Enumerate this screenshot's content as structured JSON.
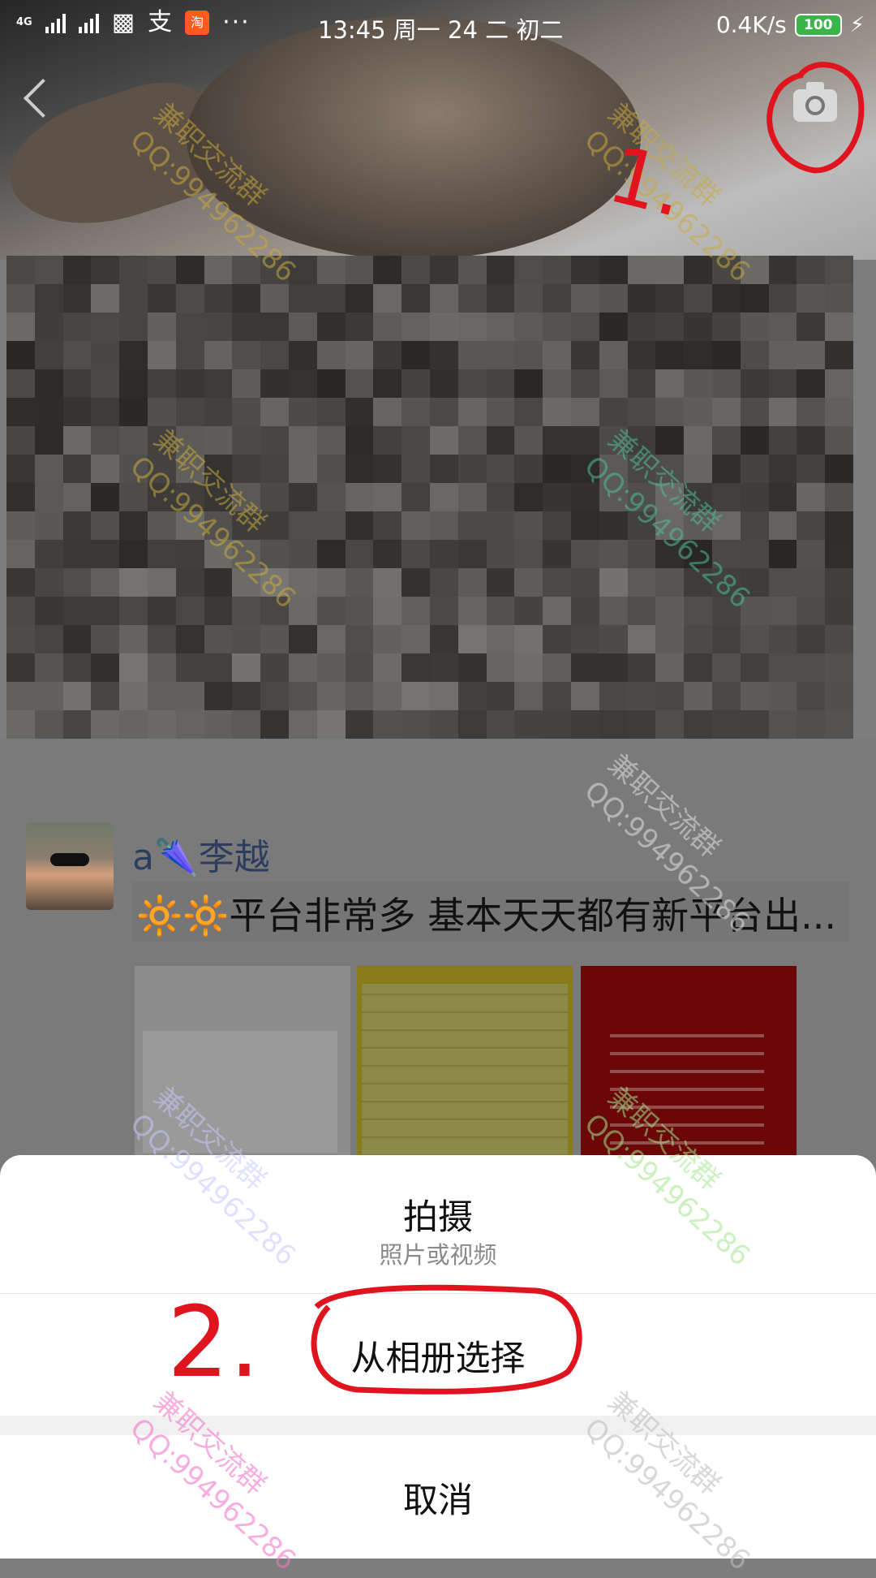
{
  "status_bar": {
    "network": "4G",
    "time": "13:45 周一 24 二 初二",
    "speed": "0.4K/s",
    "battery": "100",
    "icons": [
      "signal-icon",
      "signal-icon",
      "message-icon",
      "alipay-icon",
      "taobao-icon",
      "more-dots-icon",
      "charging-icon"
    ],
    "taobao_label": "淘"
  },
  "header": {
    "back_icon": "back-chevron-icon",
    "camera_icon": "camera-icon"
  },
  "post": {
    "author": "a🌂李越",
    "text": "🔆🔆平台非常多 基本天天都有新平台出...",
    "thumbnails": [
      "image-thumbnail",
      "image-thumbnail",
      "image-thumbnail"
    ]
  },
  "watermark": {
    "line1": "兼职交流群",
    "line2": "QQ:99496228​6"
  },
  "annotations": {
    "step1": "1.",
    "step2": "2."
  },
  "action_sheet": {
    "shoot_title": "拍摄",
    "shoot_subtitle": "照片或视频",
    "album": "从相册选择",
    "cancel": "取消"
  },
  "colors": {
    "annotation_red": "#e0141e",
    "battery_green": "#39b54a",
    "name_blue": "#2d3d60"
  }
}
